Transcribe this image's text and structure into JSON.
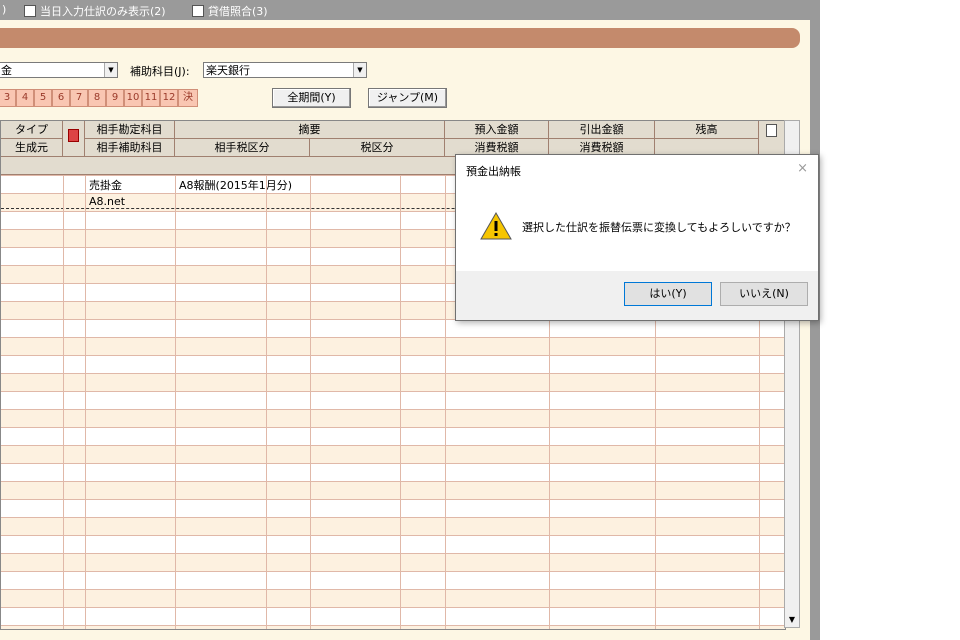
{
  "topbar": {
    "left_fragment": ")",
    "checkbox1": "当日入力仕訳のみ表示(2)",
    "checkbox2": "貸借照合(3)"
  },
  "filter": {
    "account_fragment": "金",
    "sub_account_label": "補助科目(J):",
    "sub_account_value": "楽天銀行"
  },
  "months": [
    "3",
    "4",
    "5",
    "6",
    "7",
    "8",
    "9",
    "10",
    "11",
    "12",
    "決"
  ],
  "buttons": {
    "all_period": "全期間(Y)",
    "jump": "ジャンプ(M)"
  },
  "grid": {
    "headers_row1": [
      "タイプ",
      "相手勘定科目",
      "摘要",
      "預入金額",
      "引出金額",
      "残高"
    ],
    "headers_row2": [
      "生成元",
      "相手補助科目",
      "相手税区分",
      "税区分",
      "消費税額",
      "消費税額"
    ],
    "rows": [
      {
        "account": "売掛金",
        "sub_account": "A8.net",
        "memo": "A8報酬(2015年1月分)"
      }
    ]
  },
  "dialog": {
    "title": "預金出納帳",
    "message": "選択した仕訳を振替伝票に変換してもよろしいですか？",
    "yes": "はい(Y)",
    "no": "いいえ(N)",
    "close": "×"
  },
  "colors": {
    "header_bar": "#c48a6c",
    "window_bg": "#fdf7e4",
    "month_bg": "#f9c6b2",
    "row_alt": "#fdf1e0"
  }
}
